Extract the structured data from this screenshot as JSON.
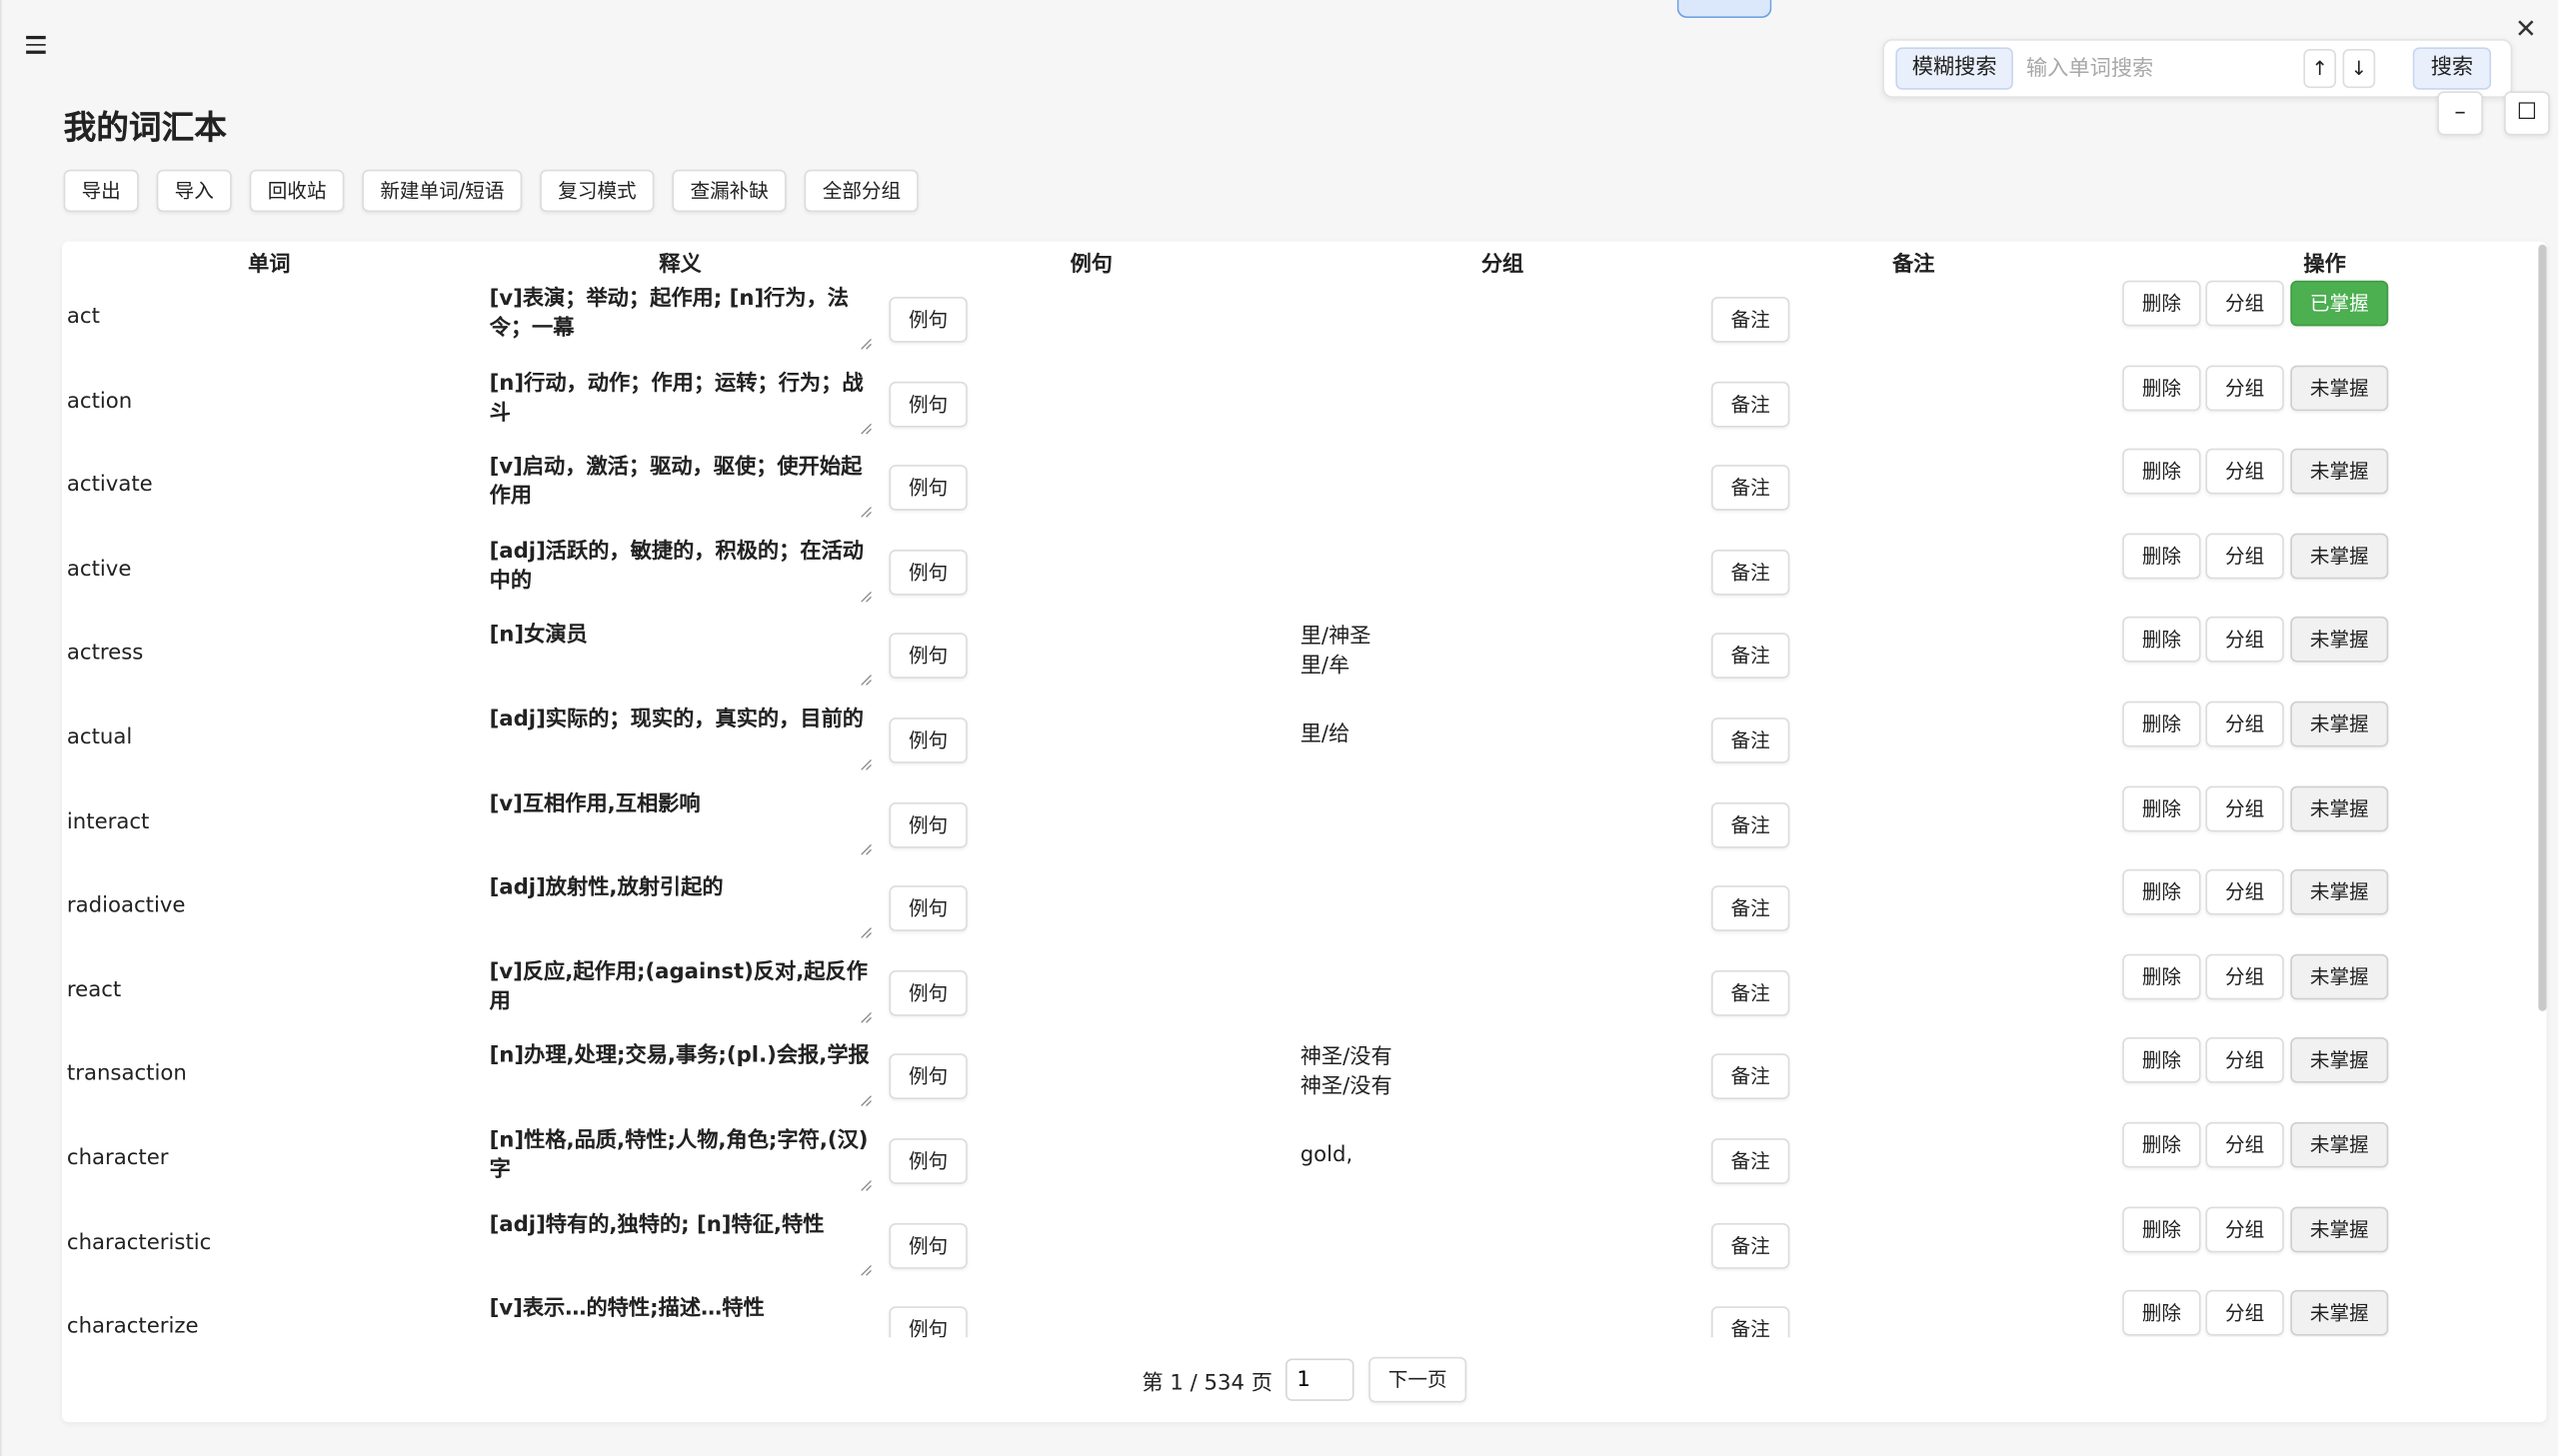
{
  "app": {
    "title": "我的词汇本",
    "close_glyph": "✕"
  },
  "search": {
    "mode_label": "模糊搜索",
    "placeholder": "输入单词搜索",
    "value": "",
    "prev_glyph": "↑",
    "next_glyph": "↓",
    "submit_label": "搜索"
  },
  "window_controls": {
    "minimize_glyph": "–",
    "maximize_glyph": "☐"
  },
  "toolbar": {
    "export_label": "导出",
    "import_label": "导入",
    "recycle_label": "回收站",
    "new_label": "新建单词/短语",
    "review_label": "复习模式",
    "check_label": "查漏补缺",
    "groups_label": "全部分组"
  },
  "table": {
    "headers": {
      "word": "单词",
      "meaning": "释义",
      "example": "例句",
      "group": "分组",
      "note": "备注",
      "actions": "操作"
    },
    "button_labels": {
      "example": "例句",
      "note": "备注",
      "delete": "删除",
      "group": "分组"
    },
    "rows": [
      {
        "word": "act",
        "meaning": "[v]表演；举动；起作用; [n]行为，法令；一幕",
        "group": "",
        "status": "已掌握",
        "mastered": true
      },
      {
        "word": "action",
        "meaning": "[n]行动，动作；作用；运转；行为；战斗",
        "group": "",
        "status": "未掌握",
        "mastered": false
      },
      {
        "word": "activate",
        "meaning": "[v]启动，激活；驱动，驱使；使开始起作用",
        "group": "",
        "status": "未掌握",
        "mastered": false
      },
      {
        "word": "active",
        "meaning": "[adj]活跃的，敏捷的，积极的；在活动中的",
        "group": "",
        "status": "未掌握",
        "mastered": false
      },
      {
        "word": "actress",
        "meaning": "[n]女演员",
        "group": "里/神圣\n里/牟",
        "status": "未掌握",
        "mastered": false
      },
      {
        "word": "actual",
        "meaning": "[adj]实际的；现实的，真实的，目前的",
        "group": "里/给",
        "status": "未掌握",
        "mastered": false
      },
      {
        "word": "interact",
        "meaning": "[v]互相作用,互相影响",
        "group": "",
        "status": "未掌握",
        "mastered": false
      },
      {
        "word": "radioactive",
        "meaning": "[adj]放射性,放射引起的",
        "group": "",
        "status": "未掌握",
        "mastered": false
      },
      {
        "word": "react",
        "meaning": "[v]反应,起作用;(against)反对,起反作用",
        "group": "",
        "status": "未掌握",
        "mastered": false
      },
      {
        "word": "transaction",
        "meaning": "[n]办理,处理;交易,事务;(pl.)会报,学报",
        "group": "神圣/没有\n神圣/没有",
        "status": "未掌握",
        "mastered": false
      },
      {
        "word": "character",
        "meaning": "[n]性格,品质,特性;人物,角色;字符,(汉)字",
        "group": "gold,",
        "status": "未掌握",
        "mastered": false
      },
      {
        "word": "characteristic",
        "meaning": "[adj]特有的,独特的; [n]特征,特性",
        "group": "",
        "status": "未掌握",
        "mastered": false
      },
      {
        "word": "characterize",
        "meaning": "[v]表示…的特性;描述…特性",
        "group": "",
        "status": "未掌握",
        "mastered": false
      }
    ]
  },
  "pagination": {
    "summary": "第 1 / 534 页",
    "current_page": "1",
    "next_label": "下一页"
  },
  "colors": {
    "mastered_green": "#4caf50",
    "accent_blue": "#eaf0fb"
  }
}
